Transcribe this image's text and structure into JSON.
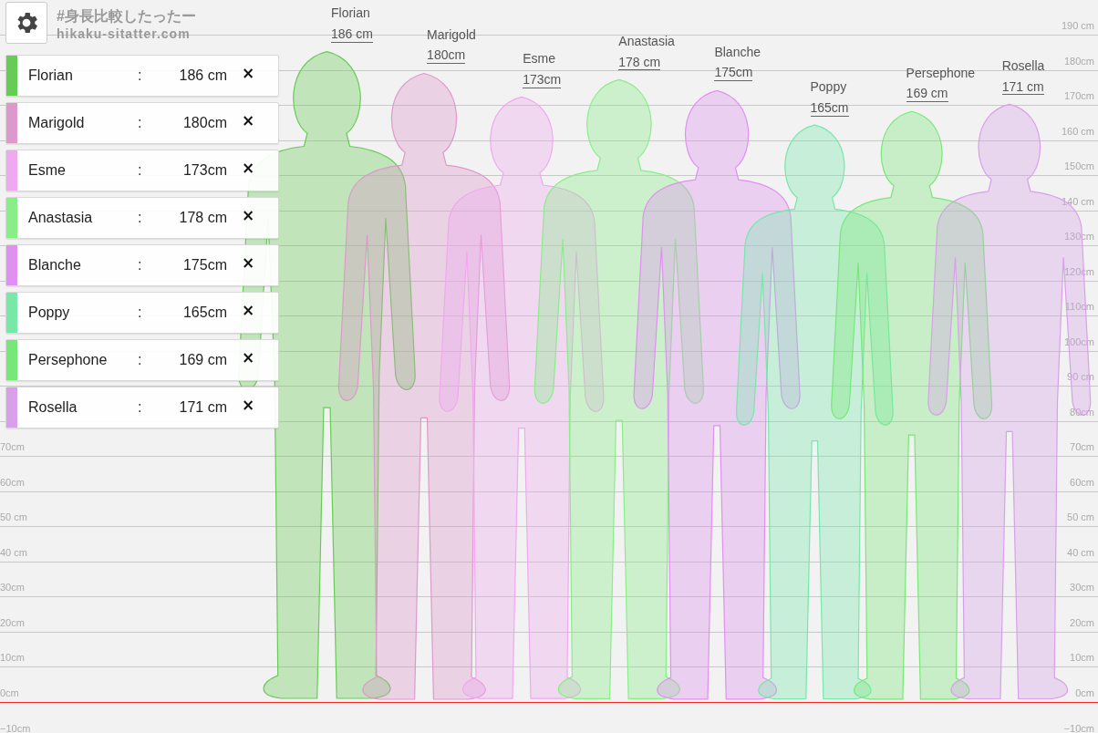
{
  "logo": {
    "title": "#身長比較したったー",
    "site": "hikaku-sitatter.com"
  },
  "ruler": [
    {
      "right": "190 cm"
    },
    {
      "right": "180cm"
    },
    {
      "right": "170cm"
    },
    {
      "right": "160 cm"
    },
    {
      "right": "150cm"
    },
    {
      "right": "140 cm"
    },
    {
      "right": "130cm"
    },
    {
      "right": "120cm"
    },
    {
      "right": "110cm"
    },
    {
      "right": "100cm"
    },
    {
      "right": "90 cm"
    },
    {
      "right": "80cm"
    },
    {
      "left": "70cm",
      "right": "70cm"
    },
    {
      "left": "60cm",
      "right": "60cm"
    },
    {
      "left": "50 cm",
      "right": "50 cm"
    },
    {
      "left": "40 cm",
      "right": "40 cm"
    },
    {
      "left": "30cm",
      "right": "30cm"
    },
    {
      "left": "20cm",
      "right": "20cm"
    },
    {
      "left": "10cm",
      "right": "10cm"
    },
    {
      "left": "0cm",
      "right": "0cm",
      "kind": "ground"
    },
    {
      "left": "−10cm",
      "right": "−10cm"
    }
  ],
  "people": [
    {
      "name": "Florian",
      "separator": ":",
      "height": "186 cm",
      "remove": "×",
      "color": "#66cc55"
    },
    {
      "name": "Marigold",
      "separator": ":",
      "height": "180cm",
      "remove": "×",
      "color": "#dd99cc"
    },
    {
      "name": "Esme",
      "separator": ":",
      "height": "173cm",
      "remove": "×",
      "color": "#f0a8f0"
    },
    {
      "name": "Anastasia",
      "separator": ":",
      "height": "178 cm",
      "remove": "×",
      "color": "#88ee88"
    },
    {
      "name": "Blanche",
      "separator": ":",
      "height": "175cm",
      "remove": "×",
      "color": "#e090f0"
    },
    {
      "name": "Poppy",
      "separator": ":",
      "height": "165cm",
      "remove": "×",
      "color": "#77e8a8"
    },
    {
      "name": "Persephone",
      "separator": ":",
      "height": "169 cm",
      "remove": "×",
      "color": "#77e877"
    },
    {
      "name": "Rosella",
      "separator": ":",
      "height": "171 cm",
      "remove": "×",
      "color": "#d8a0e8"
    }
  ],
  "figures": [
    {
      "name": "Florian",
      "height": "186 cm",
      "color": "#66cc55"
    },
    {
      "name": "Marigold",
      "height": "180cm",
      "color": "#dd99cc"
    },
    {
      "name": "Esme",
      "height": "173cm",
      "color": "#f0a8f0"
    },
    {
      "name": "Anastasia",
      "height": "178 cm",
      "color": "#88ee88"
    },
    {
      "name": "Blanche",
      "height": "175cm",
      "color": "#e090f0"
    },
    {
      "name": "Poppy",
      "height": "165cm",
      "color": "#77e8a8"
    },
    {
      "name": "Persephone",
      "height": "169 cm",
      "color": "#77e877"
    },
    {
      "name": "Rosella",
      "height": "171 cm",
      "color": "#d8a0e8"
    }
  ]
}
